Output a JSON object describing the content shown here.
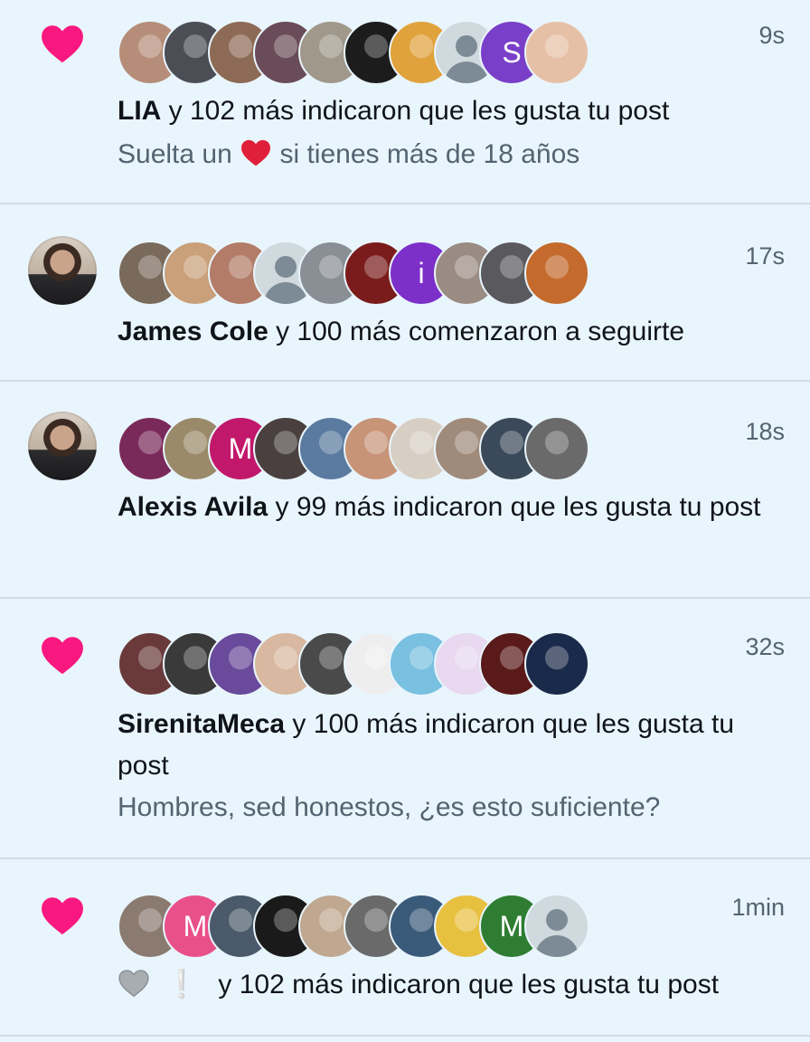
{
  "colors": {
    "like_heart": "#f91880",
    "background": "#e9f5fc",
    "secondary_text": "#536471",
    "emoji_heart": "#e0203a",
    "grey_heart": "#a8adb2"
  },
  "notifications": [
    {
      "type": "like",
      "icon": "heart-icon",
      "time": "9s",
      "actor": "LIA",
      "action": " y 102 más indicaron que les gusta tu post",
      "post_text_before": "Suelta un ",
      "post_text_emoji": "red-heart-emoji",
      "post_text_after": " si tienes más de 18 años",
      "avatars": [
        {
          "kind": "photo",
          "color": "#b58d78"
        },
        {
          "kind": "photo",
          "color": "#4b4f55"
        },
        {
          "kind": "photo",
          "color": "#8d6a55"
        },
        {
          "kind": "photo",
          "color": "#6a4c58"
        },
        {
          "kind": "photo",
          "color": "#a0988a"
        },
        {
          "kind": "photo",
          "color": "#1c1c1c"
        },
        {
          "kind": "photo",
          "color": "#e0a23c"
        },
        {
          "kind": "default"
        },
        {
          "kind": "letter",
          "letter": "S",
          "color": "#7a3fc8"
        },
        {
          "kind": "photo",
          "color": "#e6c0a6"
        }
      ]
    },
    {
      "type": "follow",
      "time": "17s",
      "actor": "James Cole",
      "action": " y 100 más comenzaron a seguirte",
      "avatars": [
        {
          "kind": "photo",
          "color": "#7a6a5c"
        },
        {
          "kind": "photo",
          "color": "#c9a07a"
        },
        {
          "kind": "photo",
          "color": "#b27c68"
        },
        {
          "kind": "default"
        },
        {
          "kind": "photo",
          "color": "#8a8f96"
        },
        {
          "kind": "photo",
          "color": "#7a1c1c"
        },
        {
          "kind": "letter",
          "letter": "i",
          "color": "#7d2fc9"
        },
        {
          "kind": "photo",
          "color": "#9a8c82"
        },
        {
          "kind": "photo",
          "color": "#5a5a5e"
        },
        {
          "kind": "photo",
          "color": "#c46a2c"
        }
      ]
    },
    {
      "type": "like",
      "time": "18s",
      "actor": "Alexis Avila",
      "action": " y 99 más indicaron que les gusta tu post",
      "avatars": [
        {
          "kind": "photo",
          "color": "#7a2a5a"
        },
        {
          "kind": "photo",
          "color": "#9a8a6a"
        },
        {
          "kind": "letter",
          "letter": "M",
          "color": "#c2186b"
        },
        {
          "kind": "photo",
          "color": "#4a4040"
        },
        {
          "kind": "photo",
          "color": "#5a7aa0"
        },
        {
          "kind": "photo",
          "color": "#c89478"
        },
        {
          "kind": "photo",
          "color": "#d8cfc4"
        },
        {
          "kind": "photo",
          "color": "#a08a7a"
        },
        {
          "kind": "photo",
          "color": "#3a4a5a"
        },
        {
          "kind": "photo",
          "color": "#6a6a6a"
        }
      ]
    },
    {
      "type": "like",
      "icon": "heart-icon",
      "time": "32s",
      "actor": "SirenitaMeca",
      "action": " y 100 más indicaron que les gusta tu post",
      "post_text": "Hombres, sed honestos, ¿es esto suficiente?",
      "avatars": [
        {
          "kind": "photo",
          "color": "#6a3a3a"
        },
        {
          "kind": "photo",
          "color": "#3a3a3a"
        },
        {
          "kind": "photo",
          "color": "#6a4a9a"
        },
        {
          "kind": "photo",
          "color": "#d8b8a0"
        },
        {
          "kind": "photo",
          "color": "#4a4a4a"
        },
        {
          "kind": "photo",
          "color": "#eeeeee"
        },
        {
          "kind": "photo",
          "color": "#7ac0e0"
        },
        {
          "kind": "photo",
          "color": "#e8d8f0"
        },
        {
          "kind": "photo",
          "color": "#5a1a1a"
        },
        {
          "kind": "photo",
          "color": "#1a2a4a"
        }
      ]
    },
    {
      "type": "like",
      "icon": "heart-icon",
      "time": "1min",
      "actor_emoji": "grey-heart-emoji",
      "actor_suffix": "❕",
      "action": "y 102 más indicaron que les gusta tu post",
      "avatars": [
        {
          "kind": "photo",
          "color": "#8a7a70"
        },
        {
          "kind": "letter",
          "letter": "M",
          "color": "#e8508a"
        },
        {
          "kind": "photo",
          "color": "#4a5a6a"
        },
        {
          "kind": "photo",
          "color": "#1a1a1a"
        },
        {
          "kind": "photo",
          "color": "#c0a890"
        },
        {
          "kind": "photo",
          "color": "#6a6a6a"
        },
        {
          "kind": "photo",
          "color": "#3a5a7a"
        },
        {
          "kind": "photo",
          "color": "#e8c040"
        },
        {
          "kind": "letter",
          "letter": "M",
          "color": "#2e7d32"
        },
        {
          "kind": "default"
        }
      ]
    }
  ]
}
